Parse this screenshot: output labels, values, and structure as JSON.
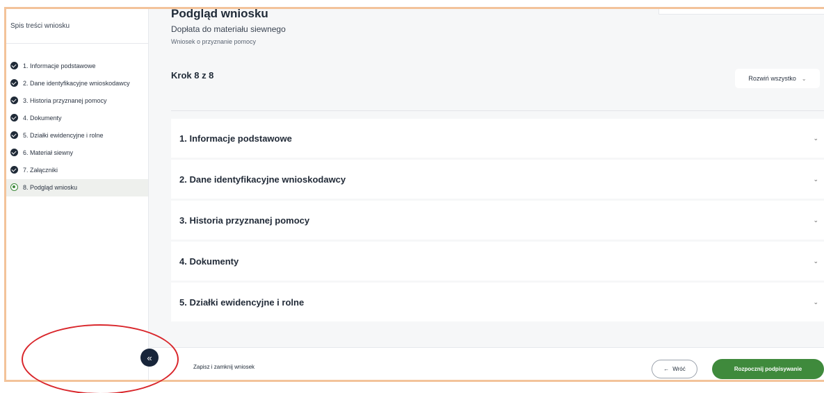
{
  "sidebar": {
    "title": "Spis treści wniosku",
    "items": [
      {
        "label": "1. Informacje podstawowe",
        "state": "done"
      },
      {
        "label": "2. Dane identyfikacyjne wnioskodawcy",
        "state": "done"
      },
      {
        "label": "3. Historia przyznanej pomocy",
        "state": "done"
      },
      {
        "label": "4. Dokumenty",
        "state": "done"
      },
      {
        "label": "5. Działki ewidencyjne i rolne",
        "state": "done"
      },
      {
        "label": "6. Materiał siewny",
        "state": "done"
      },
      {
        "label": "7. Załączniki",
        "state": "done"
      },
      {
        "label": "8. Podgląd wniosku",
        "state": "active"
      }
    ],
    "collapse_icon": "«"
  },
  "header": {
    "title": "Podgląd wniosku",
    "subtitle": "Dopłata do materiału siewnego",
    "caption": "Wniosek o przyznanie pomocy"
  },
  "step_counter": "Krok 8 z 8",
  "expand_all": {
    "label": "Rozwiń wszystko",
    "chevron": "⌄"
  },
  "sections": [
    {
      "label": "1. Informacje podstawowe"
    },
    {
      "label": "2. Dane identyfikacyjne wnioskodawcy"
    },
    {
      "label": "3. Historia przyznanej pomocy"
    },
    {
      "label": "4. Dokumenty"
    },
    {
      "label": "5. Działki ewidencyjne i rolne"
    }
  ],
  "section_chevron": "⌄",
  "footer": {
    "save_close_label": "Zapisz i zamknij wniosek",
    "back_label": "Wróć",
    "back_arrow": "←",
    "primary_label": "Rozpocznij podpisywanie"
  },
  "colors": {
    "accent_green": "#3f8a3c",
    "dark_navy": "#18253a",
    "frame_orange": "#f3c39a",
    "annotation_red": "#d9262b"
  }
}
